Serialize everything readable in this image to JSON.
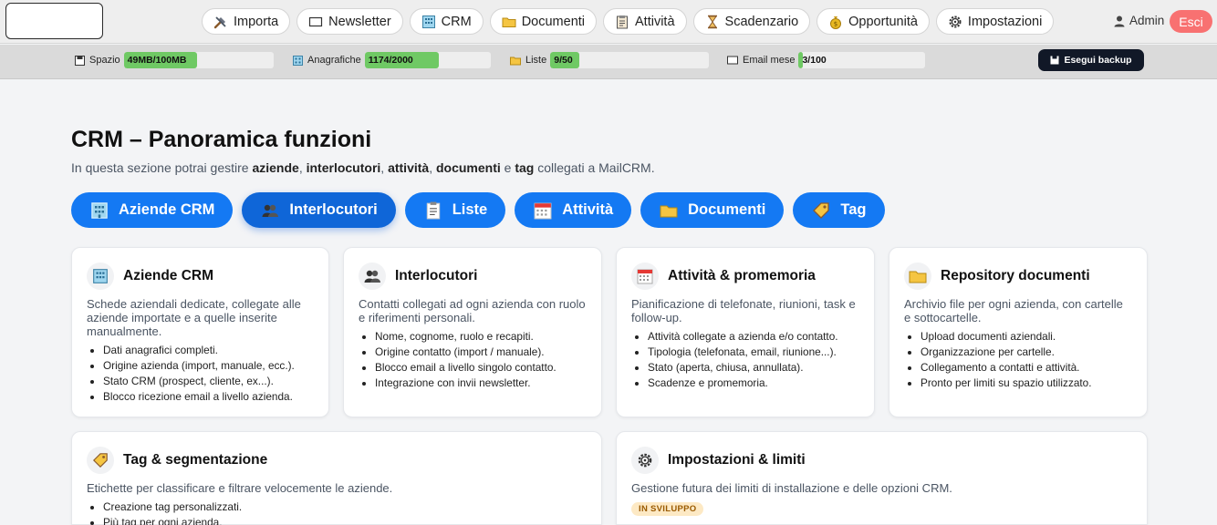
{
  "nav": {
    "items": [
      {
        "label": "Importa",
        "icon": "tools-icon"
      },
      {
        "label": "Newsletter",
        "icon": "envelope-icon"
      },
      {
        "label": "CRM",
        "icon": "building-icon"
      },
      {
        "label": "Documenti",
        "icon": "folder-icon"
      },
      {
        "label": "Attività",
        "icon": "clipboard-icon"
      },
      {
        "label": "Scadenzario",
        "icon": "hourglass-icon"
      },
      {
        "label": "Opportunità",
        "icon": "money-bag-icon"
      },
      {
        "label": "Impostazioni",
        "icon": "gear-icon"
      }
    ],
    "user": "Admin",
    "logout": "Esci"
  },
  "usage": {
    "space": {
      "label": "Spazio",
      "value": "49MB/100MB",
      "fraction": 0.49
    },
    "records": {
      "label": "Anagrafiche",
      "value": "1174/2000",
      "fraction": 0.587
    },
    "lists": {
      "label": "Liste",
      "value": "9/50",
      "fraction": 0.18
    },
    "email": {
      "label": "Email mese",
      "value": "3/100",
      "fraction": 0.03
    },
    "backup": "Esegui backup"
  },
  "page": {
    "title": "CRM – Panoramica funzioni",
    "subtitle_parts": [
      "In questa sezione potrai gestire ",
      "aziende",
      ", ",
      "interlocutori",
      ", ",
      "attività",
      ", ",
      "documenti",
      " e ",
      "tag",
      " collegati a MailCRM."
    ]
  },
  "pills": [
    "Aziende CRM",
    "Interlocutori",
    "Liste",
    "Attività",
    "Documenti",
    "Tag"
  ],
  "cards": [
    {
      "title": "Aziende CRM",
      "desc": "Schede aziendali dedicate, collegate alle aziende importate e a quelle inserite manualmente.",
      "items": [
        "Dati anagrafici completi.",
        "Origine azienda (import, manuale, ecc.).",
        "Stato CRM (prospect, cliente, ex...).",
        "Blocco ricezione email a livello azienda."
      ]
    },
    {
      "title": "Interlocutori",
      "desc": "Contatti collegati ad ogni azienda con ruolo e riferimenti personali.",
      "items": [
        "Nome, cognome, ruolo e recapiti.",
        "Origine contatto (import / manuale).",
        "Blocco email a livello singolo contatto.",
        "Integrazione con invii newsletter."
      ]
    },
    {
      "title": "Attività & promemoria",
      "desc": "Pianificazione di telefonate, riunioni, task e follow-up.",
      "items": [
        "Attività collegate a azienda e/o contatto.",
        "Tipologia (telefonata, email, riunione...).",
        "Stato (aperta, chiusa, annullata).",
        "Scadenze e promemoria."
      ]
    },
    {
      "title": "Repository documenti",
      "desc": "Archivio file per ogni azienda, con cartelle e sottocartelle.",
      "items": [
        "Upload documenti aziendali.",
        "Organizzazione per cartelle.",
        "Collegamento a contatti e attività.",
        "Pronto per limiti su spazio utilizzato."
      ]
    },
    {
      "title": "Tag & segmentazione",
      "desc": "Etichette per classificare e filtrare velocemente le aziende.",
      "items": [
        "Creazione tag personalizzati.",
        "Più tag per ogni azienda."
      ]
    },
    {
      "title": "Impostazioni & limiti",
      "desc": "Gestione futura dei limiti di installazione e delle opzioni CRM.",
      "badge": "IN SVILUPPO",
      "items": []
    }
  ]
}
